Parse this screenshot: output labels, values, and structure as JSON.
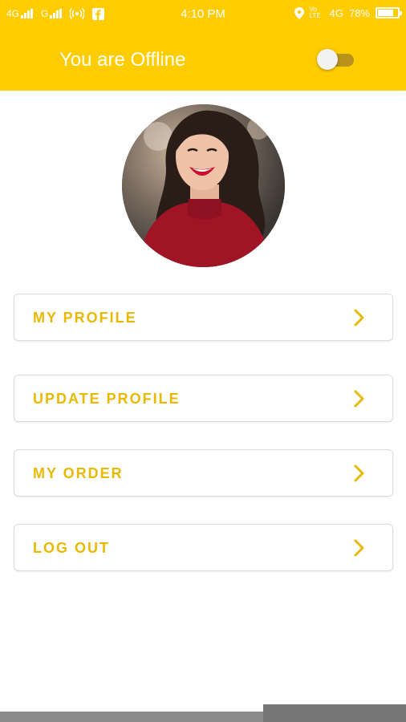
{
  "status_bar": {
    "network1": "4G",
    "network2": "G",
    "time": "4:10 PM",
    "volte": "Vo LTE",
    "network3": "4G",
    "battery_percent": "78%",
    "battery_level": 0.78,
    "icons": [
      "signal-icon",
      "signal-icon",
      "hotspot-icon",
      "facebook-icon",
      "location-icon",
      "battery-icon"
    ]
  },
  "app_bar": {
    "title": "You are Offline",
    "toggle_on": false
  },
  "profile": {
    "avatar": "profile-photo"
  },
  "menu": {
    "items": [
      {
        "label": "MY PROFILE"
      },
      {
        "label": "UPDATE PROFILE"
      },
      {
        "label": "MY ORDER"
      },
      {
        "label": "LOG OUT"
      }
    ]
  },
  "colors": {
    "primary": "#FFCC00",
    "accent_text": "#E8B900"
  }
}
